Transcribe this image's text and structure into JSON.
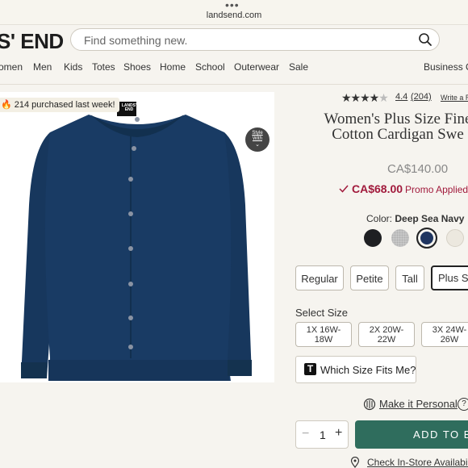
{
  "browser": {
    "url": "landsend.com"
  },
  "header": {
    "logo_text": "S' END",
    "search_placeholder": "Find something new."
  },
  "nav": {
    "items": [
      "omen",
      "Men",
      "Kids",
      "Totes",
      "Shoes",
      "Home",
      "School",
      "Outerwear",
      "Sale",
      "Business Ou"
    ]
  },
  "product_image": {
    "badge": "214 purchased last week!",
    "style_with": "Style With",
    "brand_label": "LANDS' END",
    "garment_color": "#183a63"
  },
  "rating": {
    "stars": 4.4,
    "value": "4.4",
    "reviews": "(204)",
    "write_review": "Write a R"
  },
  "product": {
    "title": "Women's Plus Size Fine Cotton Cardigan Swe",
    "original_price": "CA$140.00",
    "sale_price": "CA$68.00",
    "promo_text": "Promo Applied"
  },
  "color": {
    "label": "Color:",
    "selected": "Deep Sea Navy",
    "swatches": [
      "#1e1f22",
      "#c4c4c4",
      "#1f3560",
      "#ece8df"
    ]
  },
  "fit": {
    "options": [
      "Regular",
      "Petite",
      "Tall",
      "Plus Siz"
    ],
    "selected": "Plus Siz"
  },
  "size": {
    "label": "Select Size",
    "options": [
      {
        "line1": "1X 16W-",
        "line2": "18W"
      },
      {
        "line1": "2X 20W-",
        "line2": "22W"
      },
      {
        "line1": "3X 24W-",
        "line2": "26W"
      }
    ],
    "which_size_icon": "T",
    "which_size": "Which Size Fits Me?"
  },
  "personalize": {
    "label": "Make it Personal",
    "help": "?"
  },
  "purchase": {
    "quantity": "1",
    "minus": "−",
    "plus": "+",
    "add_to_bag": "ADD TO BA"
  },
  "store": {
    "label": "Check In-Store Availability"
  },
  "colors": {
    "accent_green": "#2f6d5d",
    "sale_red": "#a11a3c"
  }
}
